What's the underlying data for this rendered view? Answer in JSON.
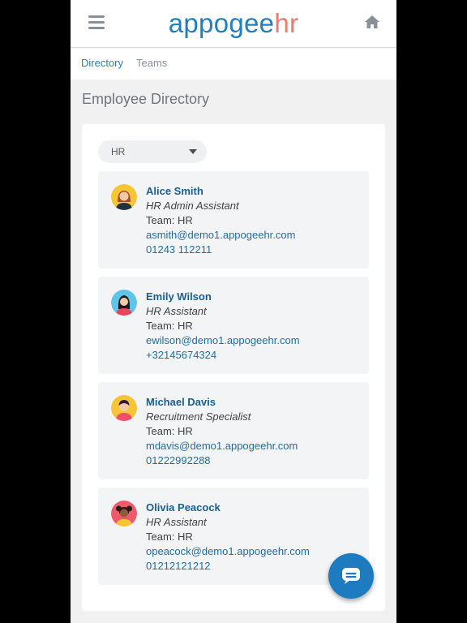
{
  "header": {
    "logo_part1": "appogee",
    "logo_part2": "hr",
    "menu_icon": "hamburger-icon",
    "home_icon": "home-icon"
  },
  "nav": {
    "tabs": [
      {
        "label": "Directory",
        "active": true
      },
      {
        "label": "Teams",
        "active": false
      }
    ]
  },
  "page": {
    "title": "Employee Directory"
  },
  "filter": {
    "selected": "HR"
  },
  "employees": [
    {
      "name": "Alice Smith",
      "role": "HR Admin Assistant",
      "team": "Team: HR",
      "email": "asmith@demo1.appogeehr.com",
      "phone": "01243 112211",
      "avatar_bg": "#f7c533"
    },
    {
      "name": "Emily Wilson",
      "role": "HR Assistant",
      "team": "Team: HR",
      "email": "ewilson@demo1.appogeehr.com",
      "phone": "+32145674324",
      "avatar_bg": "#5fc3ea"
    },
    {
      "name": "Michael Davis",
      "role": "Recruitment Specialist",
      "team": "Team: HR",
      "email": "mdavis@demo1.appogeehr.com",
      "phone": "01222992288",
      "avatar_bg": "#f7c533"
    },
    {
      "name": "Olivia Peacock",
      "role": "HR Assistant",
      "team": "Team: HR",
      "email": "opeacock@demo1.appogeehr.com",
      "phone": "01212121212",
      "avatar_bg": "#ef5a6a"
    }
  ],
  "chat_icon": "chat-icon",
  "colors": {
    "brand_blue": "#1f7fbf",
    "brand_coral": "#f07a6a",
    "link": "#1f6ea6"
  }
}
